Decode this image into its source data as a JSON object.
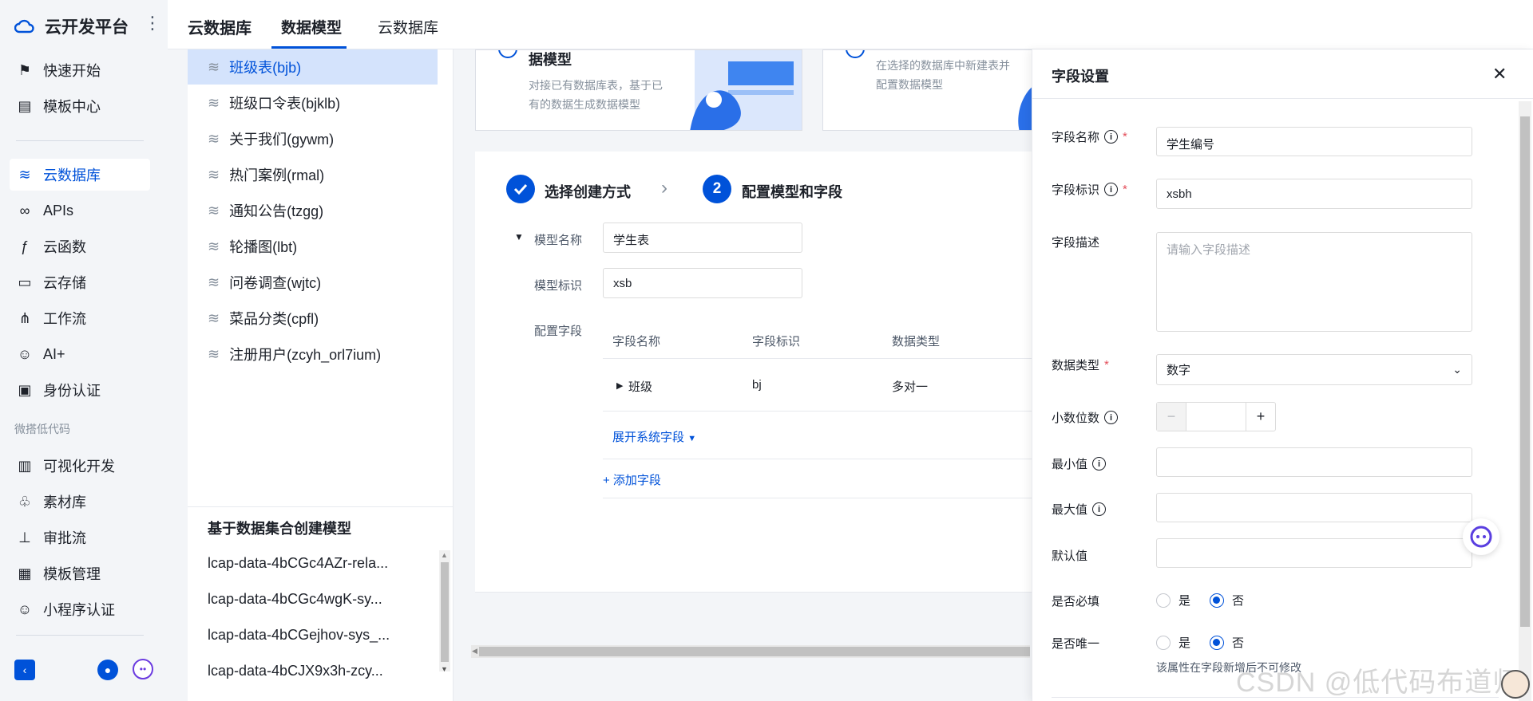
{
  "nav": {
    "brand": "云开发平台",
    "items": [
      {
        "label": "快速开始",
        "icon": "flag-icon"
      },
      {
        "label": "模板中心",
        "icon": "template-icon"
      },
      {
        "label": "云数据库",
        "icon": "database-icon",
        "active": true
      },
      {
        "label": "APIs",
        "icon": "link-icon"
      },
      {
        "label": "云函数",
        "icon": "function-icon"
      },
      {
        "label": "云存储",
        "icon": "folder-icon"
      },
      {
        "label": "工作流",
        "icon": "workflow-icon"
      },
      {
        "label": "AI+",
        "icon": "robot-icon"
      },
      {
        "label": "身份认证",
        "icon": "id-card-icon"
      }
    ],
    "section_lowcode": "微搭低代码",
    "lowcode_items": [
      {
        "label": "可视化开发",
        "icon": "layout-icon"
      },
      {
        "label": "素材库",
        "icon": "assets-icon"
      },
      {
        "label": "审批流",
        "icon": "stamp-icon"
      },
      {
        "label": "模板管理",
        "icon": "template-manage-icon"
      },
      {
        "label": "小程序认证",
        "icon": "miniprogram-icon"
      }
    ]
  },
  "header": {
    "title": "云数据库",
    "tabs": [
      {
        "label": "数据模型",
        "active": true
      },
      {
        "label": "云数据库",
        "active": false
      }
    ]
  },
  "models": [
    {
      "label": "班级表(bjb)",
      "active": true
    },
    {
      "label": "班级口令表(bjklb)"
    },
    {
      "label": "关于我们(gywm)"
    },
    {
      "label": "热门案例(rmal)"
    },
    {
      "label": "通知公告(tzgg)"
    },
    {
      "label": "轮播图(lbt)"
    },
    {
      "label": "问卷调查(wjtc)"
    },
    {
      "label": "菜品分类(cpfl)"
    },
    {
      "label": "注册用户(zcyh_orl7ium)"
    }
  ],
  "collections": {
    "title": "基于数据集合创建模型",
    "items": [
      "lcap-data-4bCGc4AZr-rela...",
      "lcap-data-4bCGc4wgK-sy...",
      "lcap-data-4bCGejhov-sys_...",
      "lcap-data-4bCJX9x3h-zcy..."
    ]
  },
  "cards": {
    "card1_title": "据模型",
    "card1_desc1": "对接已有数据库表，基于已",
    "card1_desc2": "有的数据生成数据模型",
    "card2_desc1": "在选择的数据库中新建表并",
    "card2_desc2": "配置数据模型"
  },
  "steps": {
    "step1_label": "选择创建方式",
    "step2_number": "2",
    "step2_label": "配置模型和字段"
  },
  "form": {
    "model_name_label": "模型名称",
    "model_name_value": "学生表",
    "model_id_label": "模型标识",
    "model_id_value": "xsb",
    "fields_label": "配置字段",
    "columns": [
      "字段名称",
      "字段标识",
      "数据类型"
    ],
    "rows": [
      {
        "name": "班级",
        "id": "bj",
        "type": "多对一"
      }
    ],
    "expand_system": "展开系统字段",
    "add_field": "+ 添加字段"
  },
  "drawer": {
    "title": "字段设置",
    "field_name_label": "字段名称",
    "field_name_value": "学生编号",
    "field_id_label": "字段标识",
    "field_id_value": "xsbh",
    "desc_label": "字段描述",
    "desc_placeholder": "请输入字段描述",
    "type_label": "数据类型",
    "type_value": "数字",
    "decimals_label": "小数位数",
    "decimals_value": "",
    "min_label": "最小值",
    "max_label": "最大值",
    "default_label": "默认值",
    "required_label": "是否必填",
    "unique_label": "是否唯一",
    "yes": "是",
    "no": "否",
    "required_selected": "否",
    "unique_selected": "否",
    "unique_hint": "该属性在字段新增后不可修改"
  },
  "watermark": "CSDN @低代码布道师",
  "colors": {
    "accent": "#0052d9",
    "required": "#e34d59"
  }
}
